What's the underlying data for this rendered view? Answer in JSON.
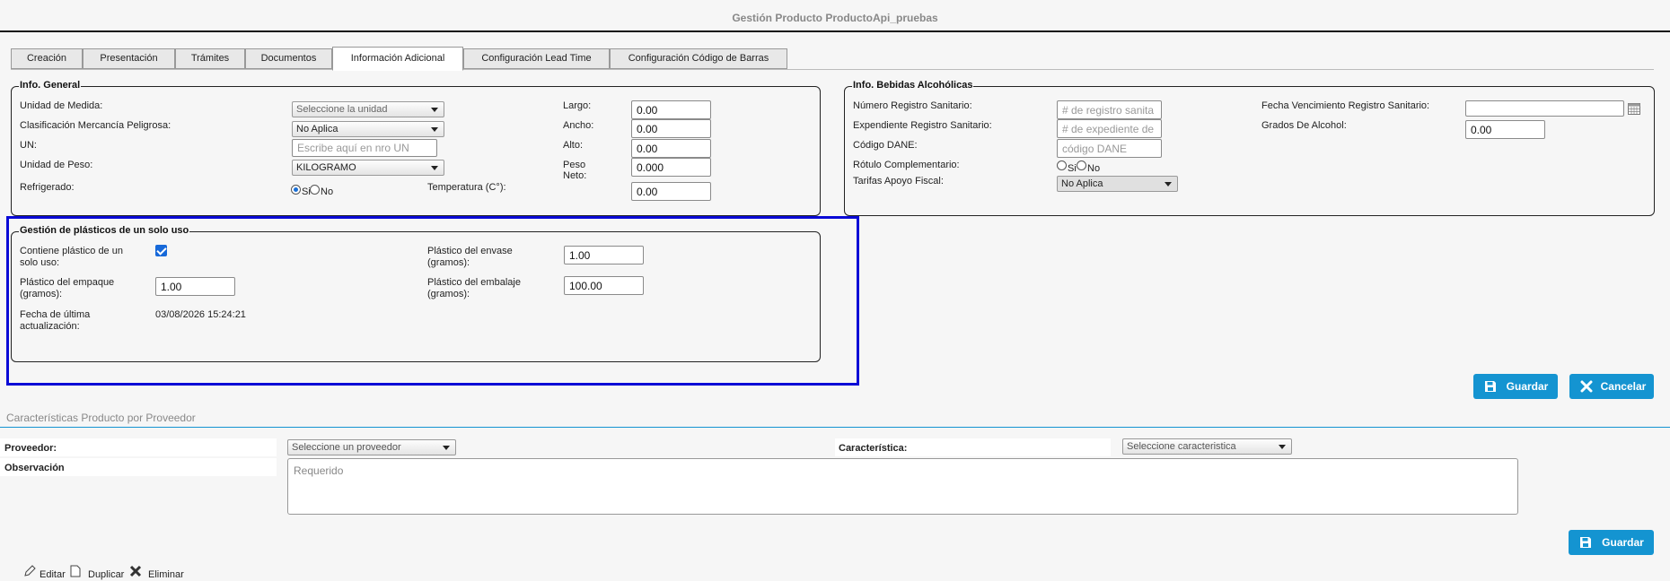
{
  "page": {
    "title": "Gestión Producto ProductoApi_pruebas"
  },
  "tabs": [
    {
      "label": "Creación"
    },
    {
      "label": "Presentación"
    },
    {
      "label": "Trámites"
    },
    {
      "label": "Documentos"
    },
    {
      "label": "Información Adicional",
      "active": true
    },
    {
      "label": "Configuración Lead Time"
    },
    {
      "label": "Configuración Código de Barras"
    }
  ],
  "general": {
    "legend": "Info. General",
    "unidad_medida_label": "Unidad de Medida:",
    "unidad_medida_value": "Seleccione la unidad",
    "mercancia_label": "Clasificación Mercancía Peligrosa:",
    "mercancia_value": "No Aplica",
    "un_label": "UN:",
    "un_placeholder": "Escribe aquí en nro UN",
    "unidad_peso_label": "Unidad de Peso:",
    "unidad_peso_value": "KILOGRAMO",
    "refrigerado_label": "Refrigerado:",
    "refrigerado_si": "Si",
    "refrigerado_no": "No",
    "refrigerado_selected": "Si",
    "largo_label": "Largo:",
    "largo_value": "0.00",
    "ancho_label": "Ancho:",
    "ancho_value": "0.00",
    "alto_label": "Alto:",
    "alto_value": "0.00",
    "peso_neto_label_1": "Peso",
    "peso_neto_label_2": "Neto:",
    "peso_neto_value": "0.000",
    "temperatura_label": "Temperatura (C°):",
    "temperatura_value": "0.00"
  },
  "bebidas": {
    "legend": "Info. Bebidas Alcohólicas",
    "registro_label": "Número Registro Sanitario:",
    "registro_placeholder": "# de registro sanita",
    "expediente_label": "Expendiente Registro Sanitario:",
    "expediente_placeholder": "# de expediente de",
    "dane_label": "Código DANE:",
    "dane_placeholder": "código DANE",
    "rotulo_label": "Rótulo Complementario:",
    "rotulo_si": "Si",
    "rotulo_no": "No",
    "tarifas_label": "Tarifas Apoyo Fiscal:",
    "tarifas_value": "No Aplica",
    "vencimiento_label": "Fecha Vencimiento Registro Sanitario:",
    "vencimiento_value": "",
    "grados_label": "Grados De Alcohol:",
    "grados_value": "0.00"
  },
  "plasticos": {
    "legend": "Gestión de plásticos de un solo uso",
    "contiene_label_1": "Contiene plástico de un",
    "contiene_label_2": "solo uso:",
    "contiene_checked": true,
    "empaque_label_1": "Plástico del empaque",
    "empaque_label_2": "(gramos):",
    "empaque_value": "1.00",
    "fecha_label_1": "Fecha de última",
    "fecha_label_2": "actualización:",
    "fecha_value": "03/08/2026 15:24:21",
    "envase_label_1": "Plástico del envase",
    "envase_label_2": "(gramos):",
    "envase_value": "1.00",
    "embalaje_label_1": "Plástico del embalaje",
    "embalaje_label_2": "(gramos):",
    "embalaje_value": "100.00"
  },
  "actions": {
    "guardar": "Guardar",
    "cancelar": "Cancelar"
  },
  "proveedor_section": {
    "title": "Características Producto por Proveedor",
    "proveedor_label": "Proveedor:",
    "proveedor_value": "Seleccione un proveedor",
    "caracteristica_label": "Característica:",
    "caracteristica_value": "Seleccione caracteristica",
    "observacion_label": "Observación",
    "observacion_placeholder": "Requerido",
    "guardar": "Guardar"
  },
  "footer": {
    "editar": "Editar",
    "duplicar": "Duplicar",
    "eliminar": "Eliminar"
  },
  "colors": {
    "accent": "#1494d1",
    "highlight": "#0a0ad6",
    "checkbox": "#1769d9"
  }
}
